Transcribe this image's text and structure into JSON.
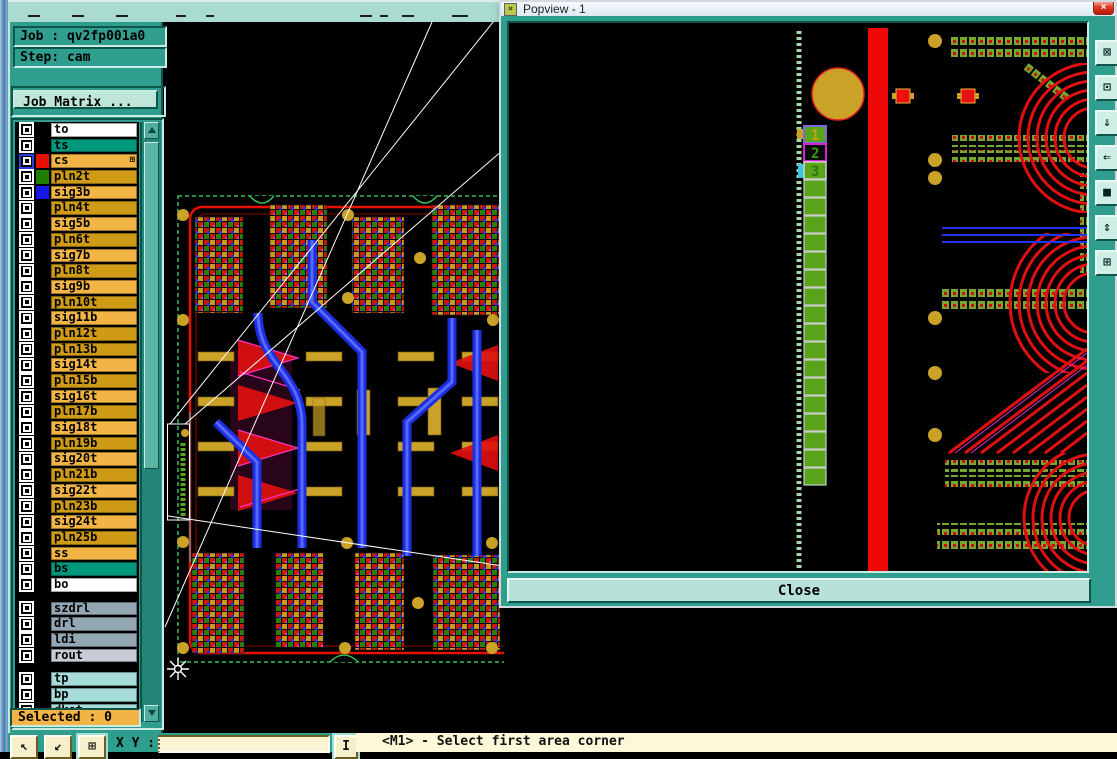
{
  "app": {
    "job_label": "Job : qv2fp001a0",
    "step_label": "Step: cam",
    "job_matrix_button": "Job Matrix ...",
    "selected_label": "Selected : 0"
  },
  "layers": {
    "rows": [
      {
        "label": "to",
        "bg": "#ffffff",
        "swatch": "#000000"
      },
      {
        "label": "ts",
        "bg": "#00987c",
        "swatch": "#000000"
      },
      {
        "label": "cs",
        "bg": "#f2b445",
        "swatch": "#e81000",
        "selected": true,
        "grid_icon": "⊞"
      },
      {
        "label": "pln2t",
        "bg": "#cf9b16",
        "swatch": "#1e7e00"
      },
      {
        "label": "sig3b",
        "bg": "#f2b445",
        "swatch": "#1616e8"
      },
      {
        "label": "pln4t",
        "bg": "#cf9b16",
        "swatch": "#000000"
      },
      {
        "label": "sig5b",
        "bg": "#f2b445",
        "swatch": "#000000"
      },
      {
        "label": "pln6t",
        "bg": "#cf9b16",
        "swatch": "#000000"
      },
      {
        "label": "sig7b",
        "bg": "#f2b445",
        "swatch": "#000000"
      },
      {
        "label": "pln8t",
        "bg": "#cf9b16",
        "swatch": "#000000"
      },
      {
        "label": "sig9b",
        "bg": "#f2b445",
        "swatch": "#000000"
      },
      {
        "label": "pln10t",
        "bg": "#cf9b16",
        "swatch": "#000000"
      },
      {
        "label": "sig11b",
        "bg": "#f2b445",
        "swatch": "#000000"
      },
      {
        "label": "pln12t",
        "bg": "#cf9b16",
        "swatch": "#000000"
      },
      {
        "label": "pln13b",
        "bg": "#cf9b16",
        "swatch": "#000000"
      },
      {
        "label": "sig14t",
        "bg": "#f2b445",
        "swatch": "#000000"
      },
      {
        "label": "pln15b",
        "bg": "#cf9b16",
        "swatch": "#000000"
      },
      {
        "label": "sig16t",
        "bg": "#f2b445",
        "swatch": "#000000"
      },
      {
        "label": "pln17b",
        "bg": "#cf9b16",
        "swatch": "#000000"
      },
      {
        "label": "sig18t",
        "bg": "#f2b445",
        "swatch": "#000000"
      },
      {
        "label": "pln19b",
        "bg": "#cf9b16",
        "swatch": "#000000"
      },
      {
        "label": "sig20t",
        "bg": "#f2b445",
        "swatch": "#000000"
      },
      {
        "label": "pln21b",
        "bg": "#cf9b16",
        "swatch": "#000000"
      },
      {
        "label": "sig22t",
        "bg": "#f2b445",
        "swatch": "#000000"
      },
      {
        "label": "pln23b",
        "bg": "#cf9b16",
        "swatch": "#000000"
      },
      {
        "label": "sig24t",
        "bg": "#f2b445",
        "swatch": "#000000"
      },
      {
        "label": "pln25b",
        "bg": "#cf9b16",
        "swatch": "#000000"
      },
      {
        "label": "ss",
        "bg": "#f2b445",
        "swatch": "#000000"
      },
      {
        "label": "bs",
        "bg": "#00987c",
        "swatch": "#000000"
      },
      {
        "label": "bo",
        "bg": "#ffffff",
        "swatch": "#000000"
      },
      {
        "label": "szdrl",
        "bg": "#93a6b3",
        "swatch": "#000000"
      },
      {
        "label": "drl",
        "bg": "#93a6b3",
        "swatch": "#000000"
      },
      {
        "label": "ldi",
        "bg": "#93a6b3",
        "swatch": "#000000"
      },
      {
        "label": "rout",
        "bg": "#c7ccd6",
        "swatch": "#000000"
      },
      {
        "label": "tp",
        "bg": "#a5dbd8",
        "swatch": "#000000"
      },
      {
        "label": "bp",
        "bg": "#a5dbd8",
        "swatch": "#000000"
      },
      {
        "label": "dkst",
        "bg": "#a5dbd8",
        "swatch": "#000000"
      }
    ]
  },
  "statusbar": {
    "xy_label": "X Y :",
    "coord_value": "",
    "message": "<M1> - Select first area corner",
    "buttons": [
      {
        "name": "select-pointer",
        "glyph": "↖"
      },
      {
        "name": "pan-pointer",
        "glyph": "↙"
      },
      {
        "name": "zoom-window",
        "glyph": "⊞"
      },
      {
        "name": "text-cursor",
        "glyph": "I"
      }
    ]
  },
  "popview": {
    "title": "Popview - 1",
    "title_icon_glyph": "×",
    "close_glyph": "×",
    "close_button": "Close",
    "legend": {
      "one": "1",
      "two": "2",
      "three": "3"
    },
    "tools": [
      {
        "name": "zoom-box",
        "glyph": "⊠"
      },
      {
        "name": "zoom-area",
        "glyph": "⊡"
      },
      {
        "name": "pan-down",
        "glyph": "⇓"
      },
      {
        "name": "pan-left",
        "glyph": "⇐"
      },
      {
        "name": "fit-view",
        "glyph": "■"
      },
      {
        "name": "scroll-vertical",
        "glyph": "⇕"
      },
      {
        "name": "grid-view",
        "glyph": "⊞"
      }
    ]
  },
  "colors": {
    "panel_teal": "#2f9e8e",
    "gold_light": "#f2b445",
    "gold_dark": "#cf9b16",
    "copper_red": "#e81000",
    "trace_blue": "#1c2fe0",
    "outline_green": "#35c055",
    "pad_gold": "#c9a227",
    "highlight_magenta": "#ff30c0"
  }
}
